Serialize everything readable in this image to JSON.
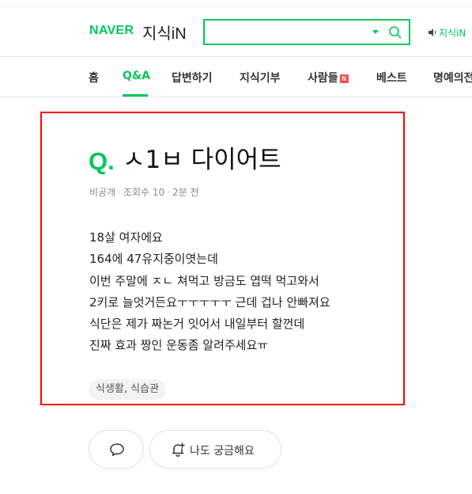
{
  "header": {
    "logo_naver": "NAVER",
    "logo_service": "지식iN",
    "search": {
      "value": "",
      "placeholder": ""
    },
    "voice_link": "지식iN"
  },
  "nav": {
    "items": [
      {
        "label": "홈",
        "active": false
      },
      {
        "label": "Q&A",
        "active": true
      },
      {
        "label": "답변하기",
        "active": false
      },
      {
        "label": "지식기부",
        "active": false
      },
      {
        "label": "사람들",
        "active": false,
        "badge": "N"
      },
      {
        "label": "베스트",
        "active": false
      },
      {
        "label": "명예의전당",
        "active": false
      }
    ]
  },
  "question": {
    "q_mark": "Q.",
    "title": "ㅅ1ㅂ 다이어트",
    "meta": {
      "author": "비공개",
      "views_label": "조회수",
      "views": "10",
      "time": "2분 전"
    },
    "body_lines": [
      "18살 여자에요",
      "164에 47유지중이엿는데",
      "이번 주말에 ㅈㄴ 쳐먹고 방금도 엽떡 먹고와서",
      "2키로 늘엇거든요ㅜㅜㅜㅜㅜ 근데 겁나 안빠져요",
      "식단은 제가 짜논거 잇어서 내일부터 할껀데",
      "진짜 효과 짱인 운동좀 알려주세요ㅠ"
    ],
    "tag": "식생활, 식습관"
  },
  "actions": {
    "curious_label": "나도 궁금해요"
  },
  "colors": {
    "brand_green": "#03c75a",
    "highlight_red": "#ff0000",
    "badge_red": "#ee4f4f"
  }
}
